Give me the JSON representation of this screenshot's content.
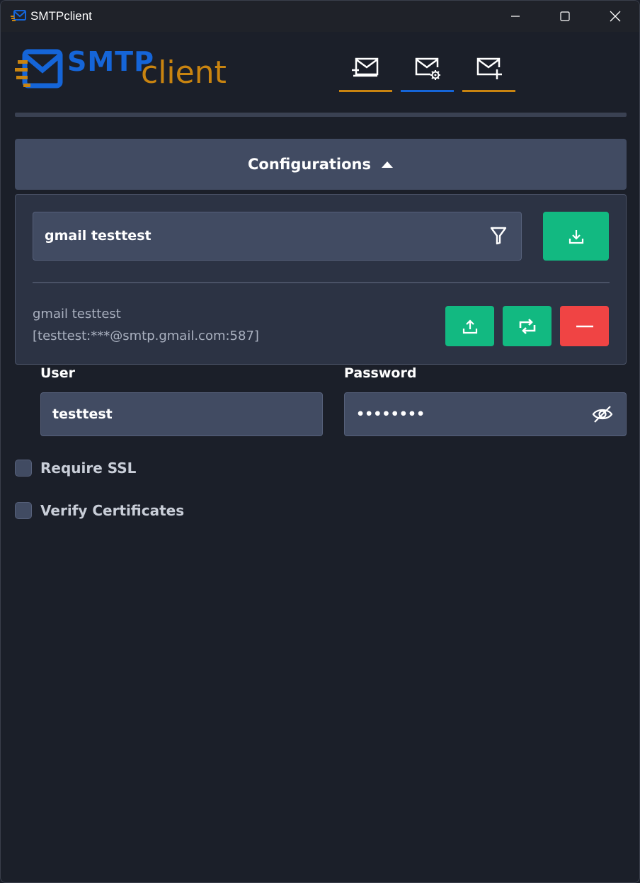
{
  "window": {
    "title": "SMTPclient",
    "icons": {
      "app": "mail-app-icon",
      "minimize": "minimize-icon",
      "maximize": "maximize-icon",
      "close": "close-icon"
    }
  },
  "logo": {
    "part1": "SMTP",
    "part2": "client"
  },
  "nav": {
    "tabs": [
      {
        "icon": "mail-send-icon",
        "underline_color": "#c98410"
      },
      {
        "icon": "mail-settings-icon",
        "underline_color": "#1565d8",
        "active": true
      },
      {
        "icon": "mail-add-icon",
        "underline_color": "#c98410"
      }
    ]
  },
  "configurations": {
    "title": "Configurations",
    "expanded": true,
    "selected": "gmail testtest",
    "current_name": "gmail testtest",
    "current_detail": "[testtest:***@smtp.gmail.com:587]",
    "icons": {
      "filter": "filter-icon",
      "download": "download-icon",
      "upload": "upload-icon",
      "replace": "replace-icon",
      "remove": "minus-icon"
    }
  },
  "form": {
    "user_label": "User",
    "user_value": "testtest",
    "password_label": "Password",
    "password_value": "••••••••",
    "require_ssl_label": "Require SSL",
    "require_ssl_checked": false,
    "verify_cert_label": "Verify Certificates",
    "verify_cert_checked": false
  },
  "colors": {
    "accent_blue": "#1565d8",
    "accent_orange": "#c98410",
    "green": "#12b981",
    "red": "#f04444",
    "background": "#1b1f29"
  }
}
